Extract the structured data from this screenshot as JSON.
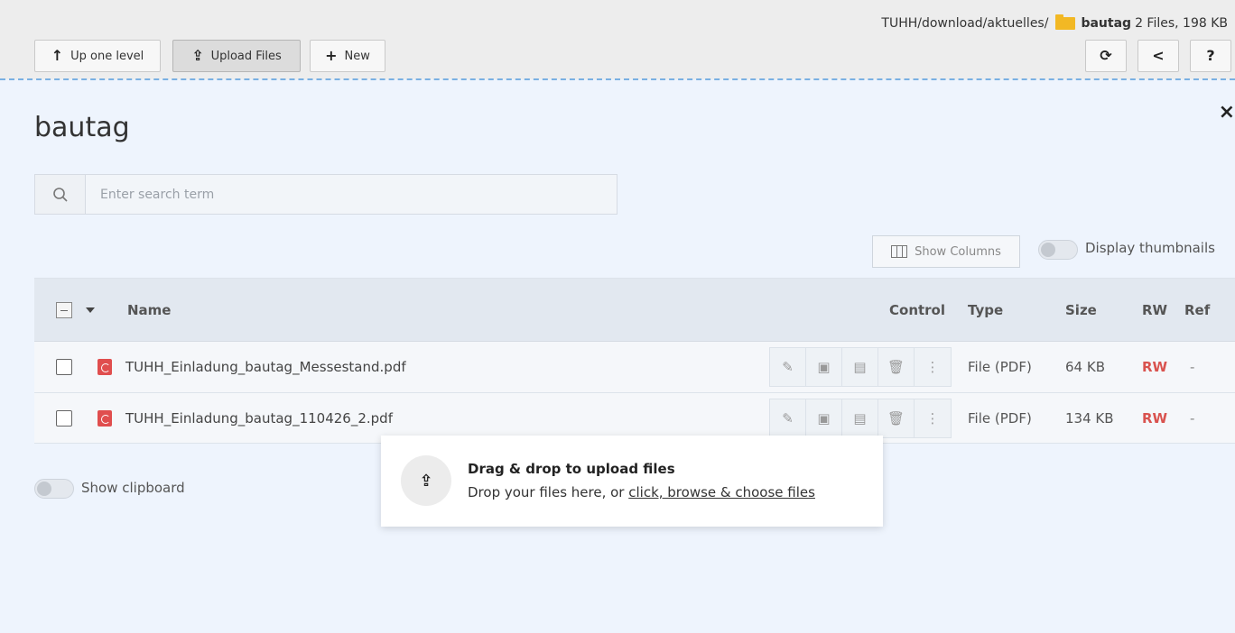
{
  "header": {
    "path": "TUHH/download/aktuelles/",
    "folder_name": "bautag",
    "summary": "2 Files, 198 KB"
  },
  "toolbar": {
    "up_label": "Up one level",
    "upload_label": "Upload Files",
    "new_label": "New",
    "refresh_icon": "refresh-icon",
    "share_icon": "share-icon",
    "help_label": "?"
  },
  "main": {
    "title": "bautag",
    "close_label": "×"
  },
  "search": {
    "placeholder": "Enter search term"
  },
  "options": {
    "show_columns_label": "Show Columns",
    "thumbnails_label": "Display thumbnails",
    "clipboard_label": "Show clipboard"
  },
  "table": {
    "headers": {
      "name": "Name",
      "control": "Control",
      "type": "Type",
      "size": "Size",
      "rw": "RW",
      "ref": "Ref"
    },
    "rows": [
      {
        "name": "TUHH_Einladung_bautag_Messestand.pdf",
        "type": "File (PDF)",
        "size": "64 KB",
        "rw": "RW",
        "ref": "-"
      },
      {
        "name": "TUHH_Einladung_bautag_110426_2.pdf",
        "type": "File (PDF)",
        "size": "134 KB",
        "rw": "RW",
        "ref": "-"
      }
    ]
  },
  "dropzone": {
    "title": "Drag & drop to upload files",
    "text": "Drop your files here, or ",
    "link": "click, browse & choose files"
  },
  "colors": {
    "accent_dashed": "#7ab0e2",
    "rw_red": "#d9534f",
    "folder_yellow": "#f2b824",
    "pdf_red": "#e04e4e"
  }
}
